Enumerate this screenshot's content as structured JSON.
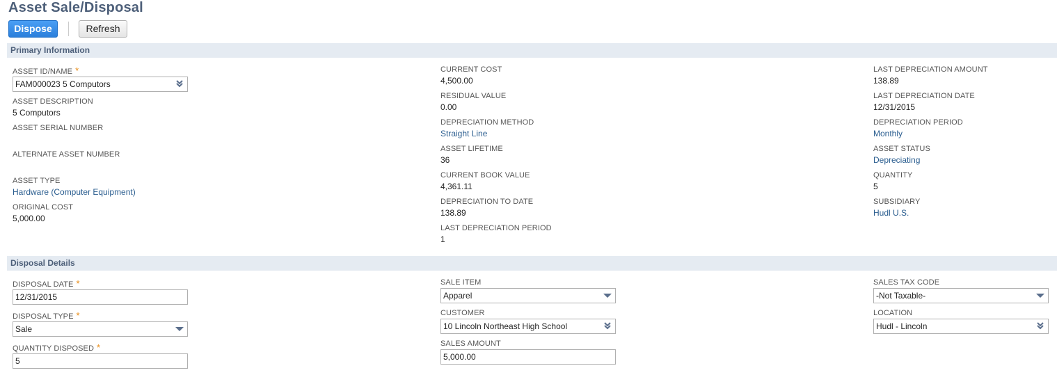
{
  "page": {
    "title": "Asset Sale/Disposal"
  },
  "toolbar": {
    "dispose_label": "Dispose",
    "refresh_label": "Refresh"
  },
  "primary": {
    "header": "Primary Information",
    "asset_id_label": "ASSET ID/NAME",
    "asset_id_value": "FAM000023 5 Computors",
    "asset_desc_label": "ASSET DESCRIPTION",
    "asset_desc_value": "5 Computors",
    "asset_serial_label": "ASSET SERIAL NUMBER",
    "alt_asset_label": "ALTERNATE ASSET NUMBER",
    "asset_type_label": "ASSET TYPE",
    "asset_type_value": "Hardware (Computer Equipment)",
    "orig_cost_label": "ORIGINAL COST",
    "orig_cost_value": "5,000.00",
    "current_cost_label": "CURRENT COST",
    "current_cost_value": "4,500.00",
    "residual_label": "RESIDUAL VALUE",
    "residual_value": "0.00",
    "dep_method_label": "DEPRECIATION METHOD",
    "dep_method_value": "Straight Line",
    "lifetime_label": "ASSET LIFETIME",
    "lifetime_value": "36",
    "book_value_label": "CURRENT BOOK VALUE",
    "book_value_value": "4,361.11",
    "dep_to_date_label": "DEPRECIATION TO DATE",
    "dep_to_date_value": "138.89",
    "last_dep_period_label": "LAST DEPRECIATION PERIOD",
    "last_dep_period_value": "1",
    "last_dep_amount_label": "LAST DEPRECIATION AMOUNT",
    "last_dep_amount_value": "138.89",
    "last_dep_date_label": "LAST DEPRECIATION DATE",
    "last_dep_date_value": "12/31/2015",
    "dep_period_label": "DEPRECIATION PERIOD",
    "dep_period_value": "Monthly",
    "status_label": "ASSET STATUS",
    "status_value": "Depreciating",
    "quantity_label": "QUANTITY",
    "quantity_value": "5",
    "subsidiary_label": "SUBSIDIARY",
    "subsidiary_value": "Hudl U.S."
  },
  "disposal": {
    "header": "Disposal Details",
    "date_label": "DISPOSAL DATE",
    "date_value": "12/31/2015",
    "type_label": "DISPOSAL TYPE",
    "type_value": "Sale",
    "qty_label": "QUANTITY DISPOSED",
    "qty_value": "5",
    "sale_item_label": "SALE ITEM",
    "sale_item_value": "Apparel",
    "customer_label": "CUSTOMER",
    "customer_value": "10 Lincoln Northeast High School",
    "sales_amount_label": "SALES AMOUNT",
    "sales_amount_value": "5,000.00",
    "tax_code_label": "SALES TAX CODE",
    "tax_code_value": "-Not Taxable-",
    "location_label": "LOCATION",
    "location_value": "Hudl - Lincoln"
  },
  "required_marker": "*"
}
